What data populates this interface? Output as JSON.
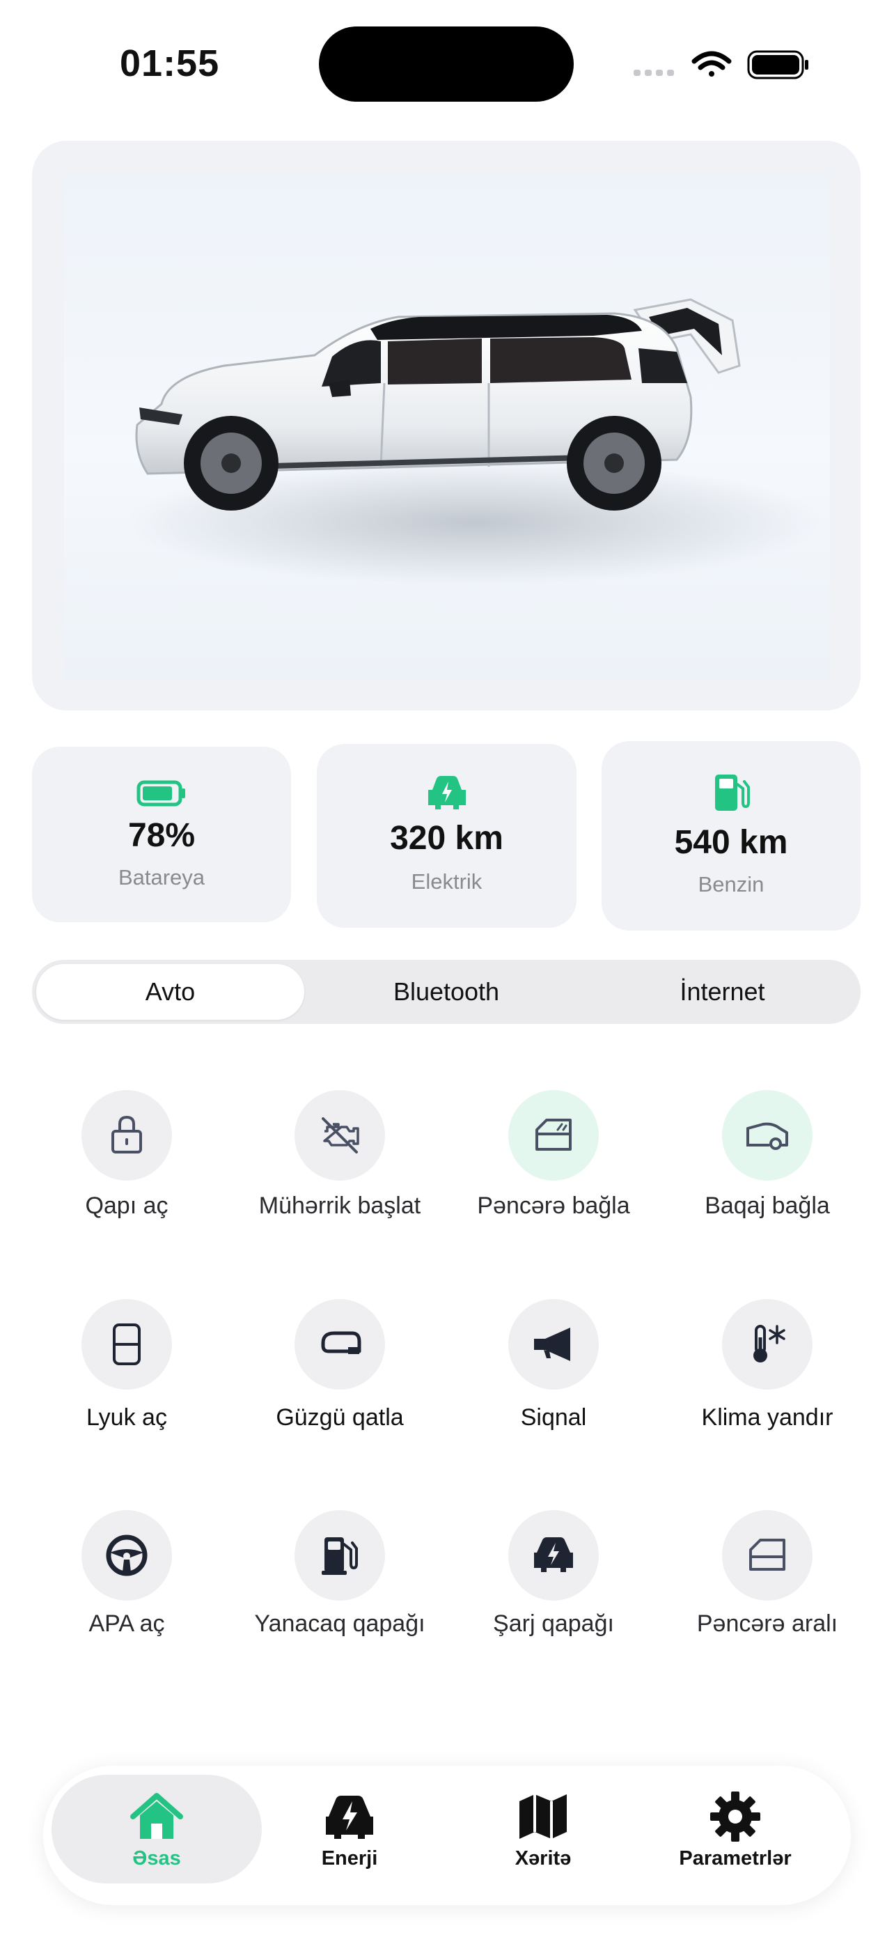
{
  "status_bar": {
    "time": "01:55",
    "icons": [
      "cellular-signal-icon",
      "wifi-icon",
      "battery-icon"
    ]
  },
  "colors": {
    "accent": "#22C383",
    "card_bg": "#F1F2F6",
    "icon_dark": "#1F2433",
    "muted_text": "#8A8A8E"
  },
  "hero": {
    "image": "white-suv-side-view-trunk-open"
  },
  "stats": [
    {
      "icon": "battery-icon",
      "value": "78%",
      "label": "Batareya",
      "battery_level": 0.78
    },
    {
      "icon": "electric-car-icon",
      "value": "320 km",
      "label": "Elektrik"
    },
    {
      "icon": "fuel-pump-icon",
      "value": "540 km",
      "label": "Benzin"
    }
  ],
  "segments": {
    "active": "Avto",
    "items": [
      "Avto",
      "Bluetooth",
      "İnternet"
    ]
  },
  "controls": [
    {
      "icon": "lock-icon",
      "label": "Qapı aç",
      "active": false
    },
    {
      "icon": "engine-icon",
      "label": "Mühərrik başlat",
      "active": false
    },
    {
      "icon": "window-icon",
      "label": "Pəncərə bağla",
      "active": true
    },
    {
      "icon": "trunk-icon",
      "label": "Baqaj bağla",
      "active": true
    },
    {
      "icon": "sunroof-icon",
      "label": "Lyuk aç",
      "active": false
    },
    {
      "icon": "mirror-icon",
      "label": "Güzgü qatla",
      "active": false
    },
    {
      "icon": "horn-icon",
      "label": "Siqnal",
      "active": false
    },
    {
      "icon": "climate-icon",
      "label": "Klima yandır",
      "active": false
    },
    {
      "icon": "steering-wheel-icon",
      "label": "APA aç",
      "active": false
    },
    {
      "icon": "fuel-cap-icon",
      "label": "Yanacaq qapağı",
      "active": false
    },
    {
      "icon": "charge-port-icon",
      "label": "Şarj qapağı",
      "active": false
    },
    {
      "icon": "window-vent-icon",
      "label": "Pəncərə aralı",
      "active": false
    }
  ],
  "tabbar": {
    "active": "Əsas",
    "items": [
      {
        "icon": "home-icon",
        "label": "Əsas"
      },
      {
        "icon": "energy-icon",
        "label": "Enerji"
      },
      {
        "icon": "map-icon",
        "label": "Xəritə"
      },
      {
        "icon": "gear-icon",
        "label": "Parametrlər"
      }
    ]
  }
}
